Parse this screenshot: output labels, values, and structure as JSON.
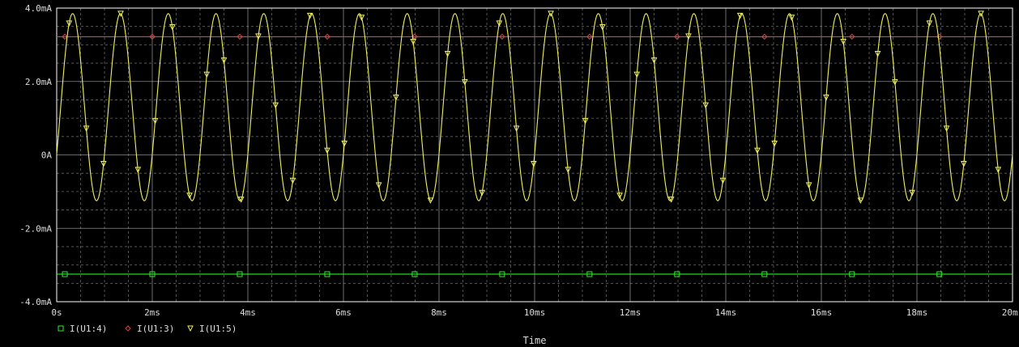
{
  "chart_data": {
    "type": "line",
    "xlabel": "Time",
    "ylabel": "",
    "title": "",
    "xlim": [
      0,
      20
    ],
    "ylim": [
      -4.0,
      4.0
    ],
    "x_ticks": [
      {
        "v": 0,
        "label": "0s"
      },
      {
        "v": 2,
        "label": "2ms"
      },
      {
        "v": 4,
        "label": "4ms"
      },
      {
        "v": 6,
        "label": "6ms"
      },
      {
        "v": 8,
        "label": "8ms"
      },
      {
        "v": 10,
        "label": "10ms"
      },
      {
        "v": 12,
        "label": "12ms"
      },
      {
        "v": 14,
        "label": "14ms"
      },
      {
        "v": 16,
        "label": "16ms"
      },
      {
        "v": 18,
        "label": "18ms"
      },
      {
        "v": 20,
        "label": "20ms"
      }
    ],
    "y_ticks": [
      {
        "v": 4.0,
        "label": "4.0mA"
      },
      {
        "v": 2.0,
        "label": "2.0mA"
      },
      {
        "v": 0,
        "label": "0A"
      },
      {
        "v": -2.0,
        "label": "-2.0mA"
      },
      {
        "v": -4.0,
        "label": "-4.0mA"
      }
    ],
    "grid": true,
    "legend_position": "bottom-left",
    "series": [
      {
        "name": "I(U1:4)",
        "color": "#2ee82e",
        "marker": "square",
        "kind": "constant",
        "value": -3.25,
        "marker_every_ms": 1.83
      },
      {
        "name": "I(U1:3)",
        "color": "#e04040",
        "marker": "diamond",
        "kind": "constant",
        "value": 3.22,
        "marker_every_ms": 1.83
      },
      {
        "name": "I(U1:5)",
        "color": "#f0f060",
        "marker": "triangle-down",
        "kind": "sine",
        "offset_mA": 1.3,
        "amplitude_mA": 2.55,
        "frequency_kHz": 1.0,
        "phase_deg": -30,
        "marker_every_ms": 0.36
      }
    ]
  }
}
